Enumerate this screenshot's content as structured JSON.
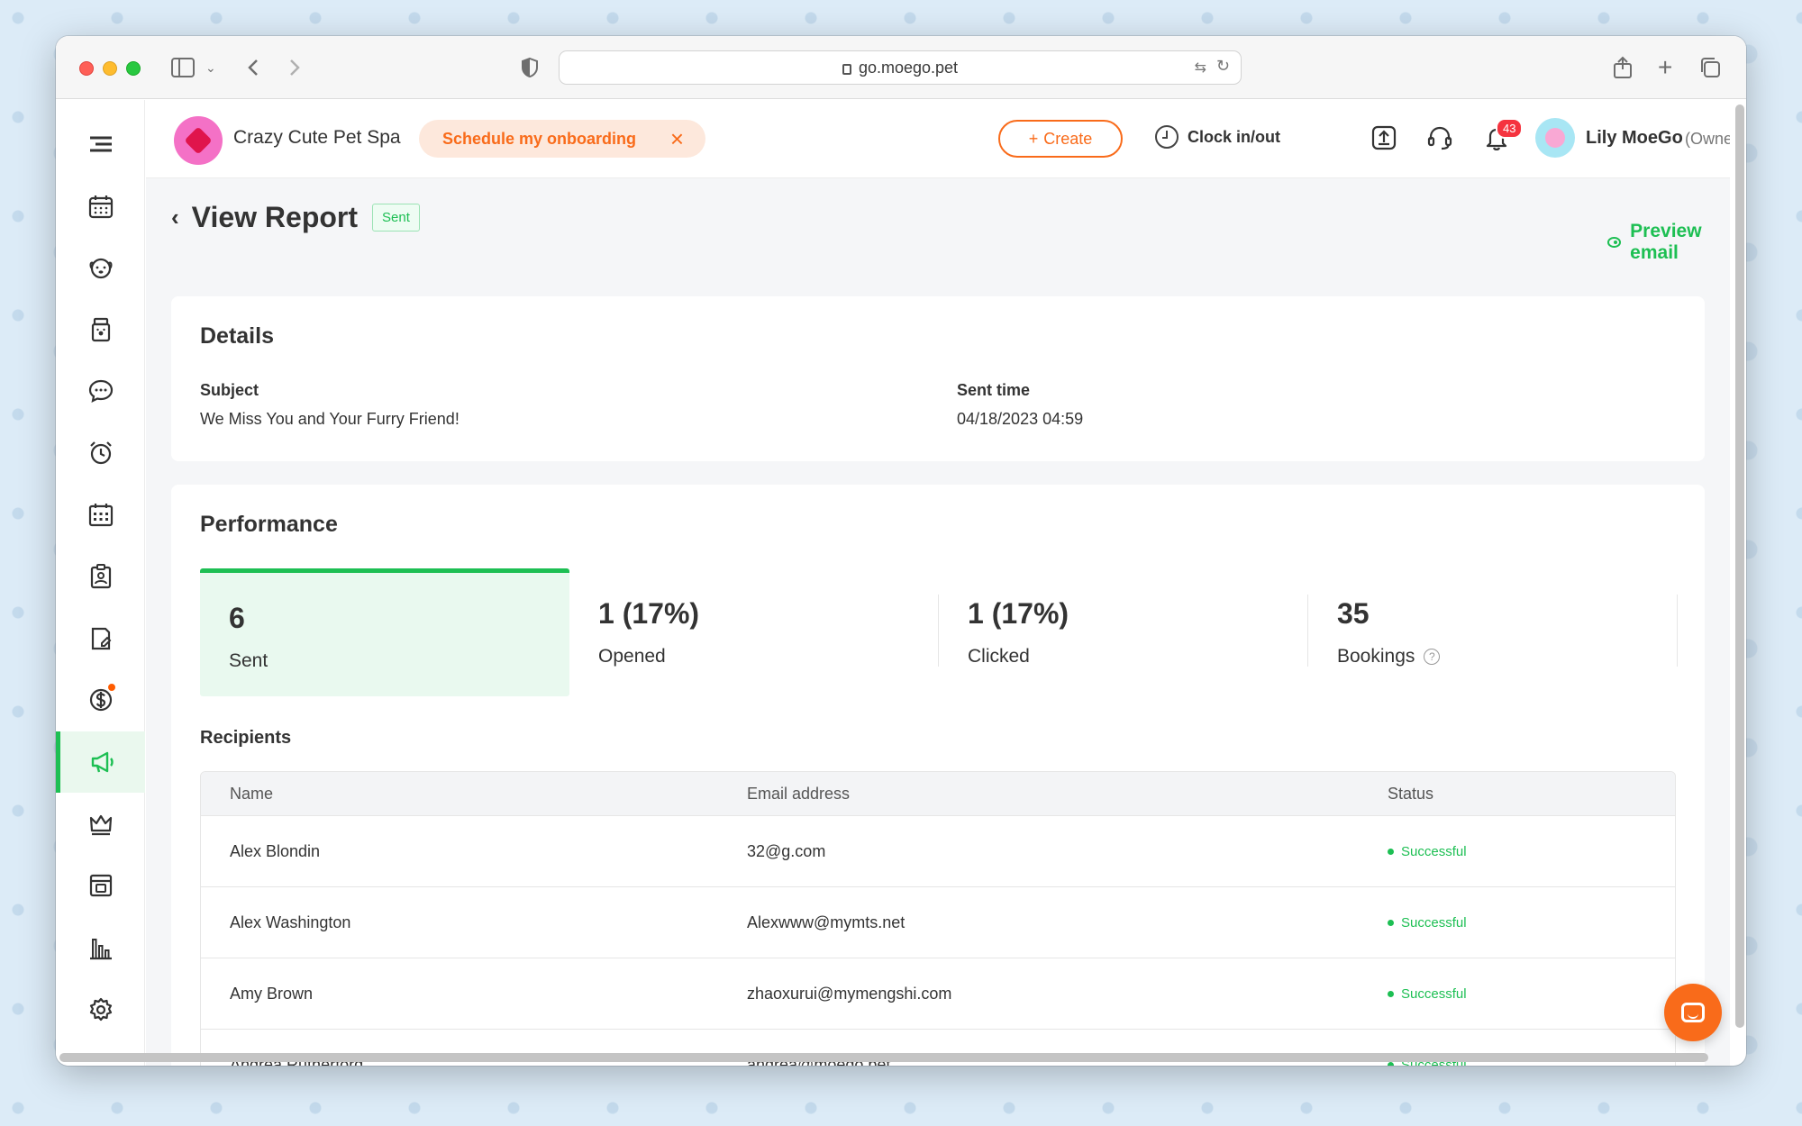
{
  "browser": {
    "url": "go.moego.pet"
  },
  "header": {
    "business_name": "Crazy Cute Pet Spa",
    "onboarding_label": "Schedule my onboarding",
    "create_label": "Create",
    "clock_label": "Clock in/out",
    "notification_count": "43",
    "user_name": "Lily MoeGo",
    "user_role": "(Owner)"
  },
  "page": {
    "title": "View Report",
    "status_tag": "Sent",
    "preview_label": "Preview email"
  },
  "details": {
    "title": "Details",
    "subject_label": "Subject",
    "subject_value": "We Miss You and Your Furry Friend!",
    "sent_time_label": "Sent time",
    "sent_time_value": "04/18/2023 04:59"
  },
  "performance": {
    "title": "Performance",
    "stats": [
      {
        "value": "6",
        "label": "Sent"
      },
      {
        "value": "1 (17%)",
        "label": "Opened"
      },
      {
        "value": "1 (17%)",
        "label": "Clicked"
      },
      {
        "value": "35",
        "label": "Bookings"
      }
    ]
  },
  "recipients": {
    "title": "Recipients",
    "columns": [
      "Name",
      "Email address",
      "Status"
    ],
    "rows": [
      {
        "name": "Alex Blondin",
        "email": "32@g.com",
        "status": "Successful"
      },
      {
        "name": "Alex Washington",
        "email": "Alexwww@mymts.net",
        "status": "Successful"
      },
      {
        "name": "Amy Brown",
        "email": "zhaoxurui@mymengshi.com",
        "status": "Successful"
      },
      {
        "name": "Andrea Rutherford",
        "email": "andrea@moego.pet",
        "status": "Successful"
      }
    ]
  },
  "colors": {
    "accent_green": "#1dbf53",
    "accent_orange": "#f96b1a"
  },
  "sidebar_icons": [
    "menu-icon",
    "calendar-icon",
    "pet-icon",
    "retail-icon",
    "message-icon",
    "reminder-icon",
    "schedule-icon",
    "client-icon",
    "agreement-icon",
    "payment-icon",
    "marketing-icon",
    "membership-icon",
    "booking-icon",
    "report-icon",
    "settings-icon"
  ]
}
